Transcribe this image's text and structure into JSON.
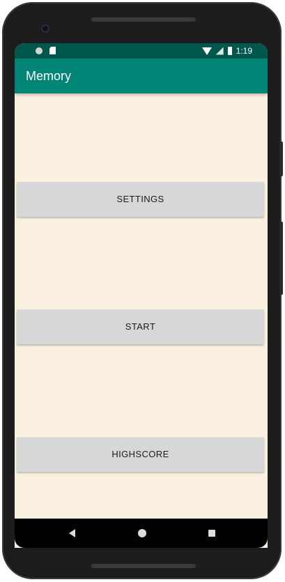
{
  "status_bar": {
    "time": "1:19",
    "icons": [
      "circle-notification-icon",
      "sd-card-icon",
      "wifi-icon",
      "signal-icon",
      "battery-icon"
    ]
  },
  "app_bar": {
    "title": "Memory",
    "color": "#008577",
    "status_color": "#00574b"
  },
  "main": {
    "background": "#faf0e0",
    "buttons": [
      {
        "label": "SETTINGS"
      },
      {
        "label": "START"
      },
      {
        "label": "HIGHSCORE"
      }
    ]
  },
  "nav_bar": {
    "icons": [
      "back-icon",
      "home-icon",
      "recents-icon"
    ]
  }
}
